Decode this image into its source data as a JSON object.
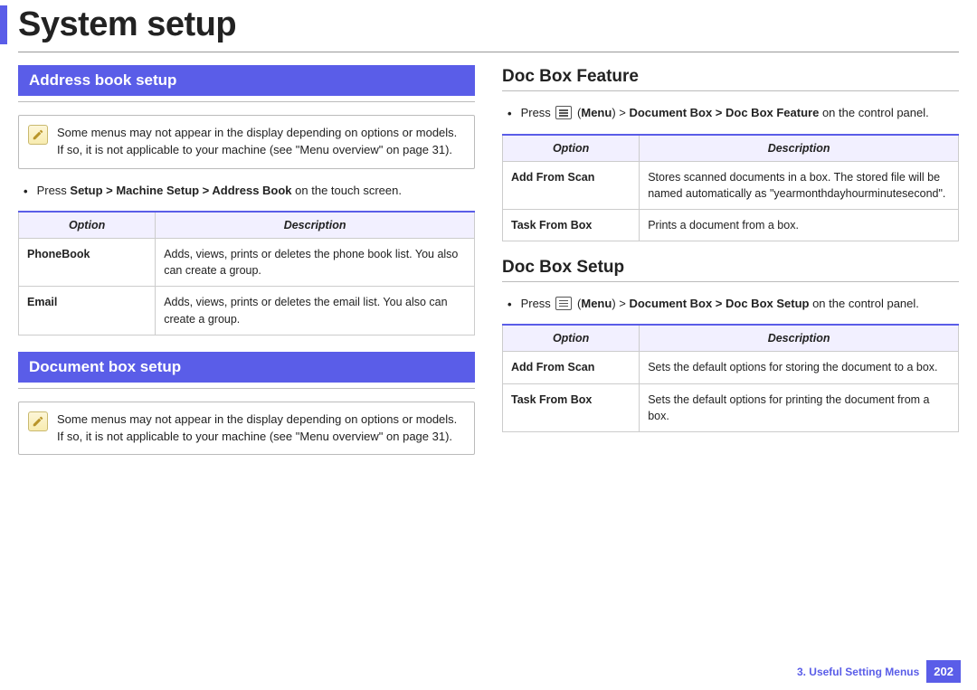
{
  "pageTitle": "System setup",
  "left": {
    "section1": {
      "header": "Address book setup",
      "note": "Some menus may not appear in the display depending on options or models. If so, it is not applicable to your machine (see \"Menu overview\" on page 31).",
      "instruction_pre": "Press ",
      "instruction_path": "Setup > Machine Setup > Address Book",
      "instruction_post": " on the touch screen.",
      "th_option": "Option",
      "th_desc": "Description",
      "rows": [
        {
          "opt": "PhoneBook",
          "desc": "Adds, views, prints or deletes the phone book list. You also can create a group."
        },
        {
          "opt": "Email",
          "desc": "Adds, views, prints or deletes the email list. You also can create a group."
        }
      ]
    },
    "section2": {
      "header": "Document box setup",
      "note": "Some menus may not appear in the display depending on options or models. If so, it is not applicable to your machine (see \"Menu overview\" on page 31)."
    }
  },
  "right": {
    "feature": {
      "heading": "Doc Box Feature",
      "instr_pre": "Press ",
      "instr_menu": "Menu",
      "instr_path": "Document Box > Doc Box Feature",
      "instr_post": " on the control panel.",
      "th_option": "Option",
      "th_desc": "Description",
      "rows": [
        {
          "opt": "Add From Scan",
          "desc": "Stores scanned documents in a box. The stored file will be named automatically as \"yearmonthdayhourminutesecond\"."
        },
        {
          "opt": "Task From Box",
          "desc": "Prints a document from a box."
        }
      ]
    },
    "setup": {
      "heading": "Doc Box Setup",
      "instr_pre": "Press ",
      "instr_menu": "Menu",
      "instr_path": "Document Box > Doc Box Setup",
      "instr_post": " on the control panel.",
      "th_option": "Option",
      "th_desc": "Description",
      "rows": [
        {
          "opt": "Add From Scan",
          "desc": "Sets the default options for storing the document to a box."
        },
        {
          "opt": "Task From Box",
          "desc": "Sets the default options for printing the document from a box."
        }
      ]
    }
  },
  "footer": {
    "chapter": "3.  Useful Setting Menus",
    "page": "202"
  }
}
